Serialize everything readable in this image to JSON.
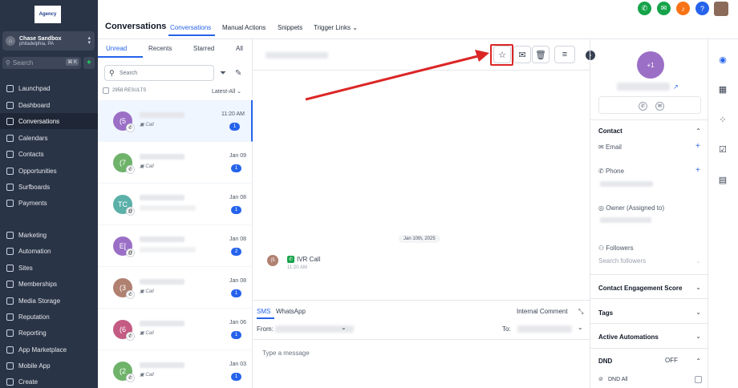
{
  "brand": {
    "logo_text": "Agency"
  },
  "location": {
    "name": "Chase Sandbox",
    "city": "philadelphia, PA",
    "icon": "store-icon"
  },
  "search": {
    "placeholder": "Search",
    "shortcut": "⌘ K"
  },
  "sidebar": {
    "items": [
      {
        "label": "Launchpad",
        "icon": "rocket-icon"
      },
      {
        "label": "Dashboard",
        "icon": "dashboard-icon"
      },
      {
        "label": "Conversations",
        "icon": "chat-icon"
      },
      {
        "label": "Calendars",
        "icon": "calendar-icon"
      },
      {
        "label": "Contacts",
        "icon": "contacts-icon"
      },
      {
        "label": "Opportunities",
        "icon": "funnel-icon"
      },
      {
        "label": "Surfboards",
        "icon": "surfboard-icon"
      },
      {
        "label": "Payments",
        "icon": "payments-icon"
      },
      {
        "label": "Marketing",
        "icon": "send-icon"
      },
      {
        "label": "Automation",
        "icon": "automation-icon"
      },
      {
        "label": "Sites",
        "icon": "sites-icon"
      },
      {
        "label": "Memberships",
        "icon": "memberships-icon"
      },
      {
        "label": "Media Storage",
        "icon": "media-icon"
      },
      {
        "label": "Reputation",
        "icon": "reputation-icon"
      },
      {
        "label": "Reporting",
        "icon": "reporting-icon"
      },
      {
        "label": "App Marketplace",
        "icon": "marketplace-icon"
      },
      {
        "label": "Mobile App",
        "icon": "mobile-icon"
      },
      {
        "label": "Create",
        "icon": "create-icon"
      }
    ]
  },
  "header": {
    "title": "Conversations",
    "tabs": [
      {
        "label": "Conversations"
      },
      {
        "label": "Manual Actions"
      },
      {
        "label": "Snippets"
      },
      {
        "label": "Trigger Links"
      }
    ]
  },
  "list": {
    "tabs": [
      {
        "label": "Unread"
      },
      {
        "label": "Recents"
      },
      {
        "label": "Starred"
      },
      {
        "label": "All"
      }
    ],
    "search_placeholder": "Search",
    "results": "2958 RESULTS",
    "sort": "Latest-All",
    "rows": [
      {
        "initials": "(5",
        "sub": "Call",
        "date": "11:20 AM",
        "count": "1",
        "color": "#9b6fc6",
        "badge": "phone-icon"
      },
      {
        "initials": "(7",
        "sub": "Call",
        "date": "Jan 09",
        "count": "1",
        "color": "#6fb36a",
        "badge": "phone-icon"
      },
      {
        "initials": "TC",
        "sub": "",
        "date": "Jan 08",
        "count": "1",
        "color": "#5bb0a8",
        "badge": "email-icon"
      },
      {
        "initials": "E[",
        "sub": "",
        "date": "Jan 08",
        "count": "2",
        "color": "#9b6fc6",
        "badge": "email-icon"
      },
      {
        "initials": "(3",
        "sub": "Call",
        "date": "Jan 08",
        "count": "1",
        "color": "#b08070",
        "badge": "phone-icon"
      },
      {
        "initials": "(6",
        "sub": "Call",
        "date": "Jan 06",
        "count": "1",
        "color": "#c45b82",
        "badge": "phone-icon"
      },
      {
        "initials": "(2",
        "sub": "Call",
        "date": "Jan 03",
        "count": "1",
        "color": "#6fb36a",
        "badge": "phone-icon"
      }
    ]
  },
  "thread": {
    "date_chip": "Jan 10th, 2025",
    "message_avatar": "(5",
    "message": "IVR Call",
    "time": "11:20 AM"
  },
  "composer": {
    "tabs": [
      {
        "label": "SMS"
      },
      {
        "label": "WhatsApp"
      }
    ],
    "internal_comment": "Internal Comment",
    "from_label": "From:",
    "to_label": "To:",
    "placeholder": "Type a message"
  },
  "contact": {
    "avatar": "+1",
    "sections": {
      "contact": "Contact",
      "email": "Email",
      "phone": "Phone",
      "owner": "Owner (Assigned to)",
      "followers": "Followers",
      "followers_placeholder": "Search followers",
      "engagement": "Contact Engagement Score",
      "tags": "Tags",
      "automations": "Active Automations",
      "dnd": "DND",
      "dnd_state": "OFF",
      "dnd_all": "DND All"
    }
  },
  "colors": {
    "sidebar_bg": "#2a3447",
    "accent": "#2563eb",
    "highlight": "#dc2626"
  }
}
